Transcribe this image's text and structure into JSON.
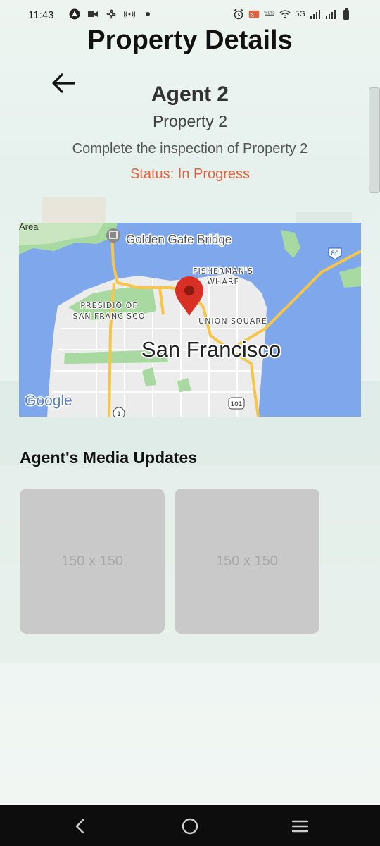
{
  "status_bar": {
    "time": "11:43",
    "left_icons": [
      "navigation-icon",
      "video-icon",
      "fan-icon",
      "hotspot-icon",
      "dot-icon"
    ],
    "right_icons": [
      "alarm-icon",
      "cast-icon",
      "volte-icon",
      "wifi-icon",
      "signal-icon",
      "signal-icon",
      "battery-icon"
    ],
    "network_label": "5G",
    "volte_label": "VoLTE2"
  },
  "header": {
    "title": "Property Details"
  },
  "task": {
    "agent_name": "Agent 2",
    "property_name": "Property 2",
    "description": "Complete the inspection of Property 2",
    "status": "Status: In Progress",
    "status_color": "#e0633f"
  },
  "map": {
    "labels": {
      "area": "Area",
      "golden_gate": "Golden Gate Bridge",
      "fishermans_wharf_1": "FISHERMAN'S",
      "fishermans_wharf_2": "WHARF",
      "presidio_1": "PRESIDIO OF",
      "presidio_2": "SAN FRANCISCO",
      "union_square": "UNION SQUARE",
      "city": "San Francisco",
      "google": "Google",
      "shield_80": "80",
      "shield_101": "101",
      "shield_1": "1"
    },
    "water_color": "#7fa8ec",
    "pin_color": "#d93025"
  },
  "media": {
    "title": "Agent's Media Updates",
    "items": [
      {
        "placeholder": "150 x 150"
      },
      {
        "placeholder": "150 x 150"
      }
    ]
  },
  "nav_bar": {
    "icons": [
      "back-icon",
      "home-icon",
      "recents-icon"
    ]
  }
}
